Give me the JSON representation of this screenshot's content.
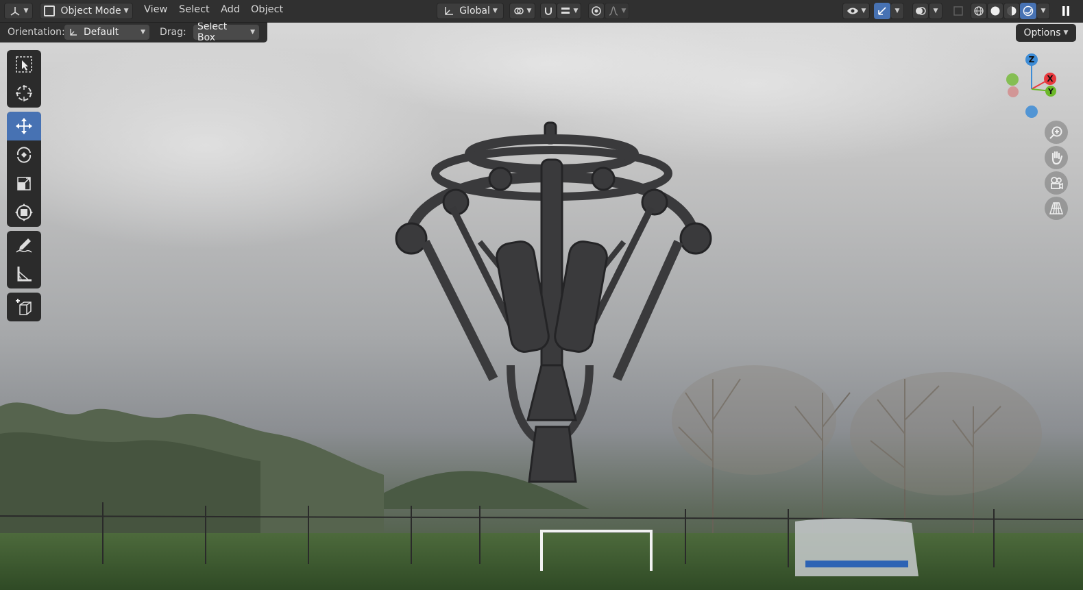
{
  "header": {
    "editor_type_icon": "3d-viewport-icon",
    "mode": "Object Mode",
    "menus": [
      "View",
      "Select",
      "Add",
      "Object"
    ],
    "transform_orientation": "Global",
    "right_icons": [
      "visibility-icon",
      "gizmo-icon",
      "overlay-icon",
      "xray-icon",
      "wireframe-shading-icon",
      "solid-shading-icon",
      "material-shading-icon",
      "rendered-shading-icon"
    ]
  },
  "tool_settings": {
    "orientation_label": "Orientation:",
    "orientation_value": "Default",
    "drag_label": "Drag:",
    "drag_value": "Select Box",
    "options_label": "Options"
  },
  "toolbar": {
    "tools": [
      "select-box",
      "cursor",
      "move",
      "rotate",
      "scale",
      "transform",
      "annotate",
      "measure",
      "add-cube"
    ],
    "active_tool": "move"
  },
  "gizmo": {
    "z_label": "Z",
    "x_label": "X",
    "y_label": "Y"
  },
  "colors": {
    "accent": "#4772b3",
    "header_bg": "#303030",
    "x_axis": "#e8383d",
    "y_axis": "#6cb829",
    "z_axis": "#3d8cd6"
  }
}
